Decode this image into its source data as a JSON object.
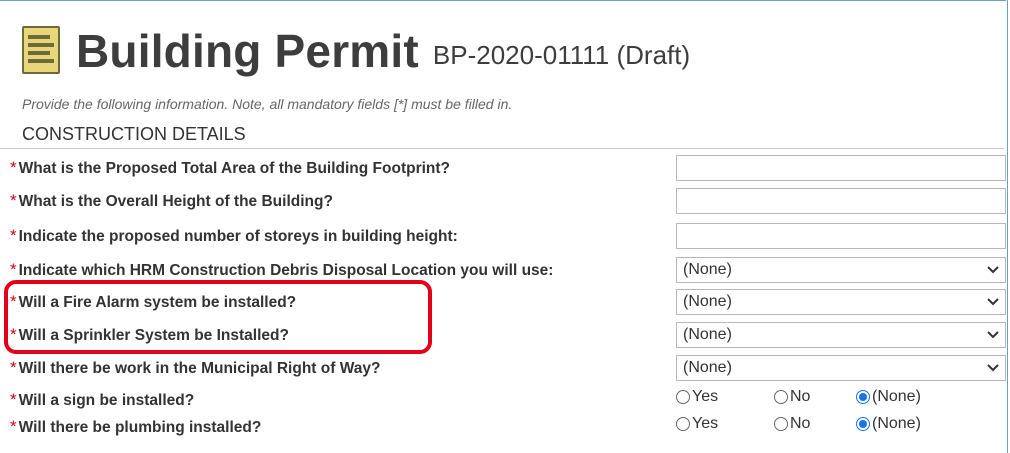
{
  "header": {
    "title": "Building Permit",
    "subtitle": "BP-2020-01111 (Draft)",
    "icon": "document-icon"
  },
  "instructions": "Provide the following information. Note, all mandatory fields [*] must be filled in.",
  "section": {
    "title": "CONSTRUCTION DETAILS"
  },
  "required_marker": "*",
  "fields": [
    {
      "label": "What is the Proposed Total Area of the Building Footprint?",
      "type": "text",
      "value": ""
    },
    {
      "label": "What is the Overall Height of the Building?",
      "type": "text",
      "value": ""
    },
    {
      "label": "Indicate the proposed number of storeys in building height:",
      "type": "text",
      "value": ""
    },
    {
      "label": "Indicate which HRM Construction Debris Disposal Location you will use:",
      "type": "select",
      "value": "(None)"
    },
    {
      "label": "Will a Fire Alarm system be installed?",
      "type": "select",
      "value": "(None)"
    },
    {
      "label": "Will a Sprinkler System be Installed?",
      "type": "select",
      "value": "(None)"
    },
    {
      "label": "Will there be work in the Municipal Right of Way?",
      "type": "select",
      "value": "(None)"
    },
    {
      "label": "Will a sign be installed?",
      "type": "radio",
      "options": [
        "Yes",
        "No",
        "(None)"
      ],
      "selected": "(None)"
    },
    {
      "label": "Will there be plumbing installed?",
      "type": "radio",
      "options": [
        "Yes",
        "No",
        "(None)"
      ],
      "selected": "(None)"
    }
  ],
  "colors": {
    "required": "#d0021b",
    "highlight": "#e2001a",
    "radio_selected": "#1a73e8"
  }
}
